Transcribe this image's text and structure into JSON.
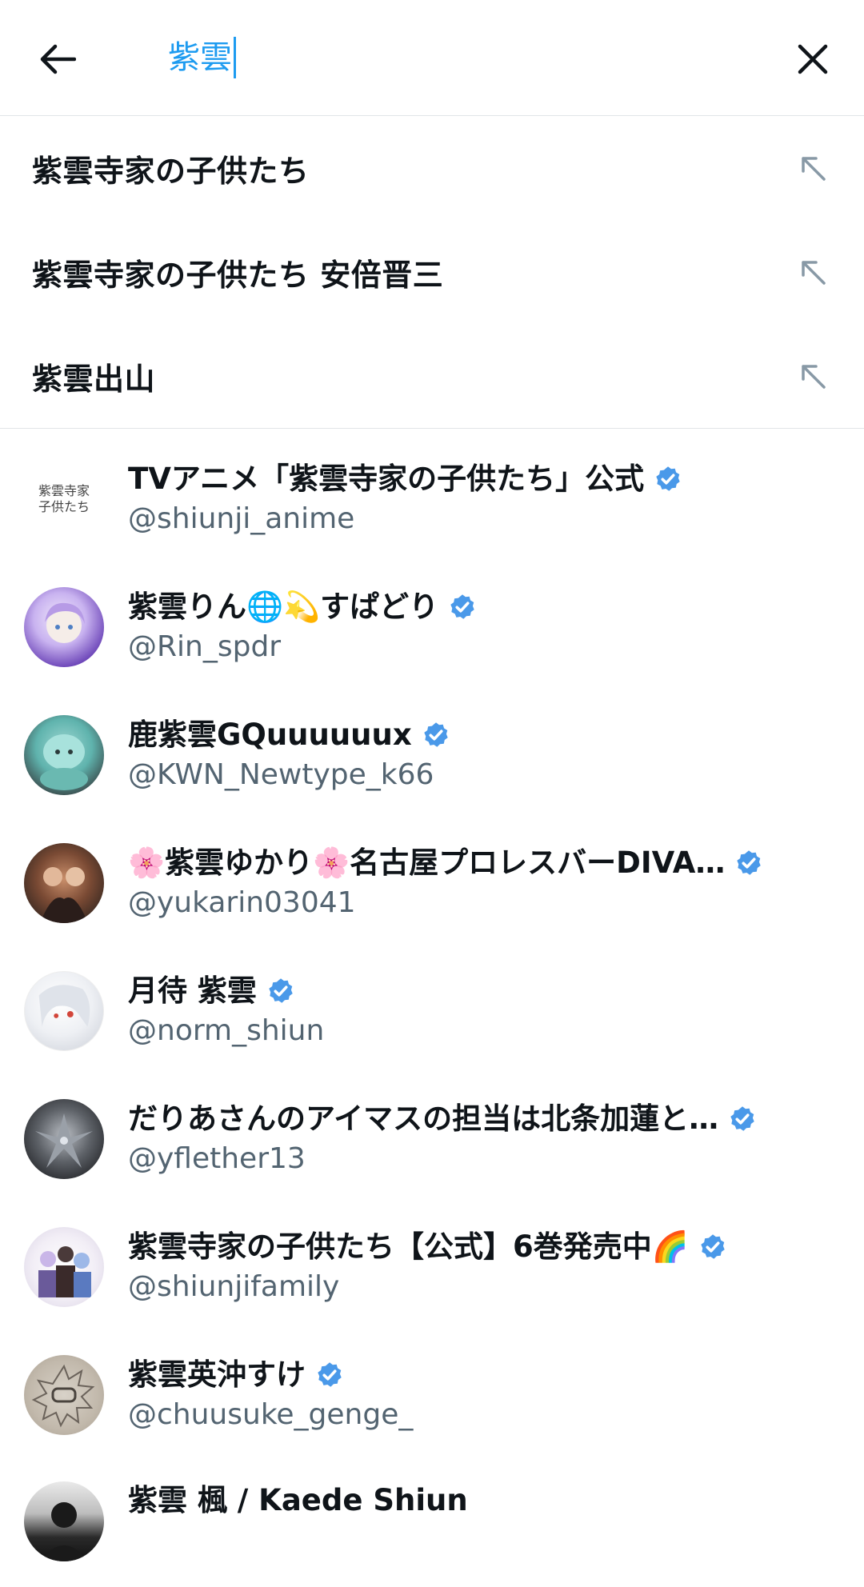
{
  "search": {
    "query": "紫雲"
  },
  "suggestions": [
    {
      "text": "紫雲寺家の子供たち"
    },
    {
      "text": "紫雲寺家の子供たち 安倍晋三"
    },
    {
      "text": "紫雲出山"
    }
  ],
  "users": [
    {
      "name": "TVアニメ「紫雲寺家の子供たち」公式",
      "handle": "@shiunji_anime",
      "verified": true,
      "avatar_text": "紫雲寺家\n子供たち"
    },
    {
      "name": "紫雲りん🌐💫すぱどり",
      "handle": "@Rin_spdr",
      "verified": true
    },
    {
      "name": "鹿紫雲GQuuuuuux",
      "handle": "@KWN_Newtype_k66",
      "verified": true
    },
    {
      "name": "🌸紫雲ゆかり🌸名古屋プロレスバーDIVA…",
      "handle": "@yukarin03041",
      "verified": true
    },
    {
      "name": "月待 紫雲",
      "handle": "@norm_shiun",
      "verified": true
    },
    {
      "name": "だりあさんのアイマスの担当は北条加蓮と…",
      "handle": "@yflether13",
      "verified": true
    },
    {
      "name": "紫雲寺家の子供たち【公式】6巻発売中🌈",
      "handle": "@shiunjifamily",
      "verified": true
    },
    {
      "name": "紫雲英沖すけ",
      "handle": "@chuusuke_genge_",
      "verified": true
    },
    {
      "name": "紫雲 楓 / Kaede Shiun",
      "handle": "",
      "verified": false
    }
  ],
  "colors": {
    "accent": "#1d9bf0",
    "verified": "#4a99e9",
    "text": "#0f1419",
    "secondary": "#536471"
  },
  "icons": {
    "back": "arrow-left-icon",
    "clear": "close-icon",
    "suggestion": "arrow-up-left-icon",
    "verified": "verified-badge-icon"
  }
}
